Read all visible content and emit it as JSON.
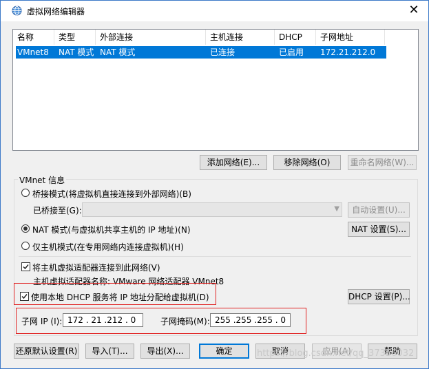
{
  "window": {
    "title": "虚拟网络编辑器",
    "close": "✕"
  },
  "table": {
    "columns": [
      "名称",
      "类型",
      "外部连接",
      "主机连接",
      "DHCP",
      "子网地址"
    ],
    "rows": [
      [
        "VMnet8",
        "NAT 模式",
        "NAT 模式",
        "已连接",
        "已启用",
        "172.21.212.0"
      ]
    ]
  },
  "list_buttons": {
    "add": "添加网络(E)...",
    "remove": "移除网络(O)",
    "rename": "重命名网络(W)..."
  },
  "vmnet_info": {
    "group_label": "VMnet 信息",
    "bridge_label": "桥接模式(将虚拟机直接连接到外部网络)(B)",
    "bridged_to_label": "已桥接至(G):",
    "bridged_to_value": "",
    "auto_settings": "自动设置(U)...",
    "nat_label": "NAT 模式(与虚拟机共享主机的 IP 地址)(N)",
    "nat_settings": "NAT 设置(S)...",
    "hostonly_label": "仅主机模式(在专用网络内连接虚拟机)(H)",
    "connect_adapter_label": "将主机虚拟适配器连接到此网络(V)",
    "adapter_name_label": "主机虚拟适配器名称: VMware 网络适配器 VMnet8",
    "dhcp_label": "使用本地 DHCP 服务将 IP 地址分配给虚拟机(D)",
    "dhcp_settings": "DHCP 设置(P)...",
    "subnet_ip_label": "子网 IP (I):",
    "subnet_ip_value": "172 . 21 .212 . 0",
    "subnet_mask_label": "子网掩码(M):",
    "subnet_mask_value": "255 .255 .255 . 0",
    "selected_mode": "nat",
    "connect_adapter_checked": true,
    "dhcp_checked": true
  },
  "bottom_buttons": {
    "restore": "还原默认设置(R)",
    "import": "导入(T)...",
    "export": "导出(X)...",
    "ok": "确定",
    "cancel": "取消",
    "apply": "应用(A)",
    "help": "帮助"
  },
  "watermark": "https://blog.csdn.net/qq_37356032",
  "colors": {
    "selection": "#0078d7",
    "highlight_box": "#e02020",
    "window_border": "#3b78c8"
  }
}
